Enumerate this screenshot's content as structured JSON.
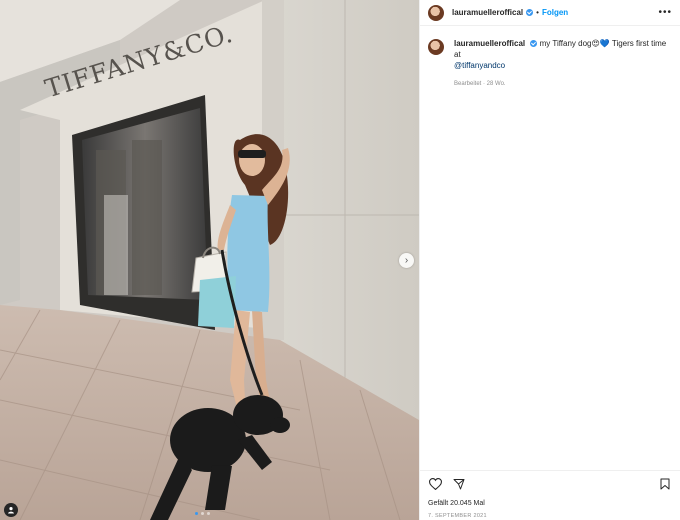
{
  "media": {
    "store_sign": "TIFFANY&CO.",
    "carousel": {
      "count": 3,
      "active_index": 0
    }
  },
  "post": {
    "username": "lauramuelleroffical",
    "follow_label": "Folgen",
    "more_label": "•••",
    "dot_separator": "•"
  },
  "caption": {
    "username": "lauramuelleroffical",
    "text": "my Tiffany dog😍💙 Tigers first time at",
    "mention": "@tiffanyandco",
    "meta": "Bearbeitet · 28 Wo."
  },
  "actions": {
    "likes": "Gefällt 20.045 Mal",
    "date": "7. SEPTEMBER 2021"
  },
  "icons": {
    "like": "heart-icon",
    "share": "paper-plane-icon",
    "save": "bookmark-icon",
    "next": "chevron-right-icon",
    "tag": "user-tag-icon"
  },
  "colors": {
    "accent": "#0095f6",
    "verified": "#3897f0",
    "mention": "#00376b",
    "muted": "#8e8e8e"
  }
}
